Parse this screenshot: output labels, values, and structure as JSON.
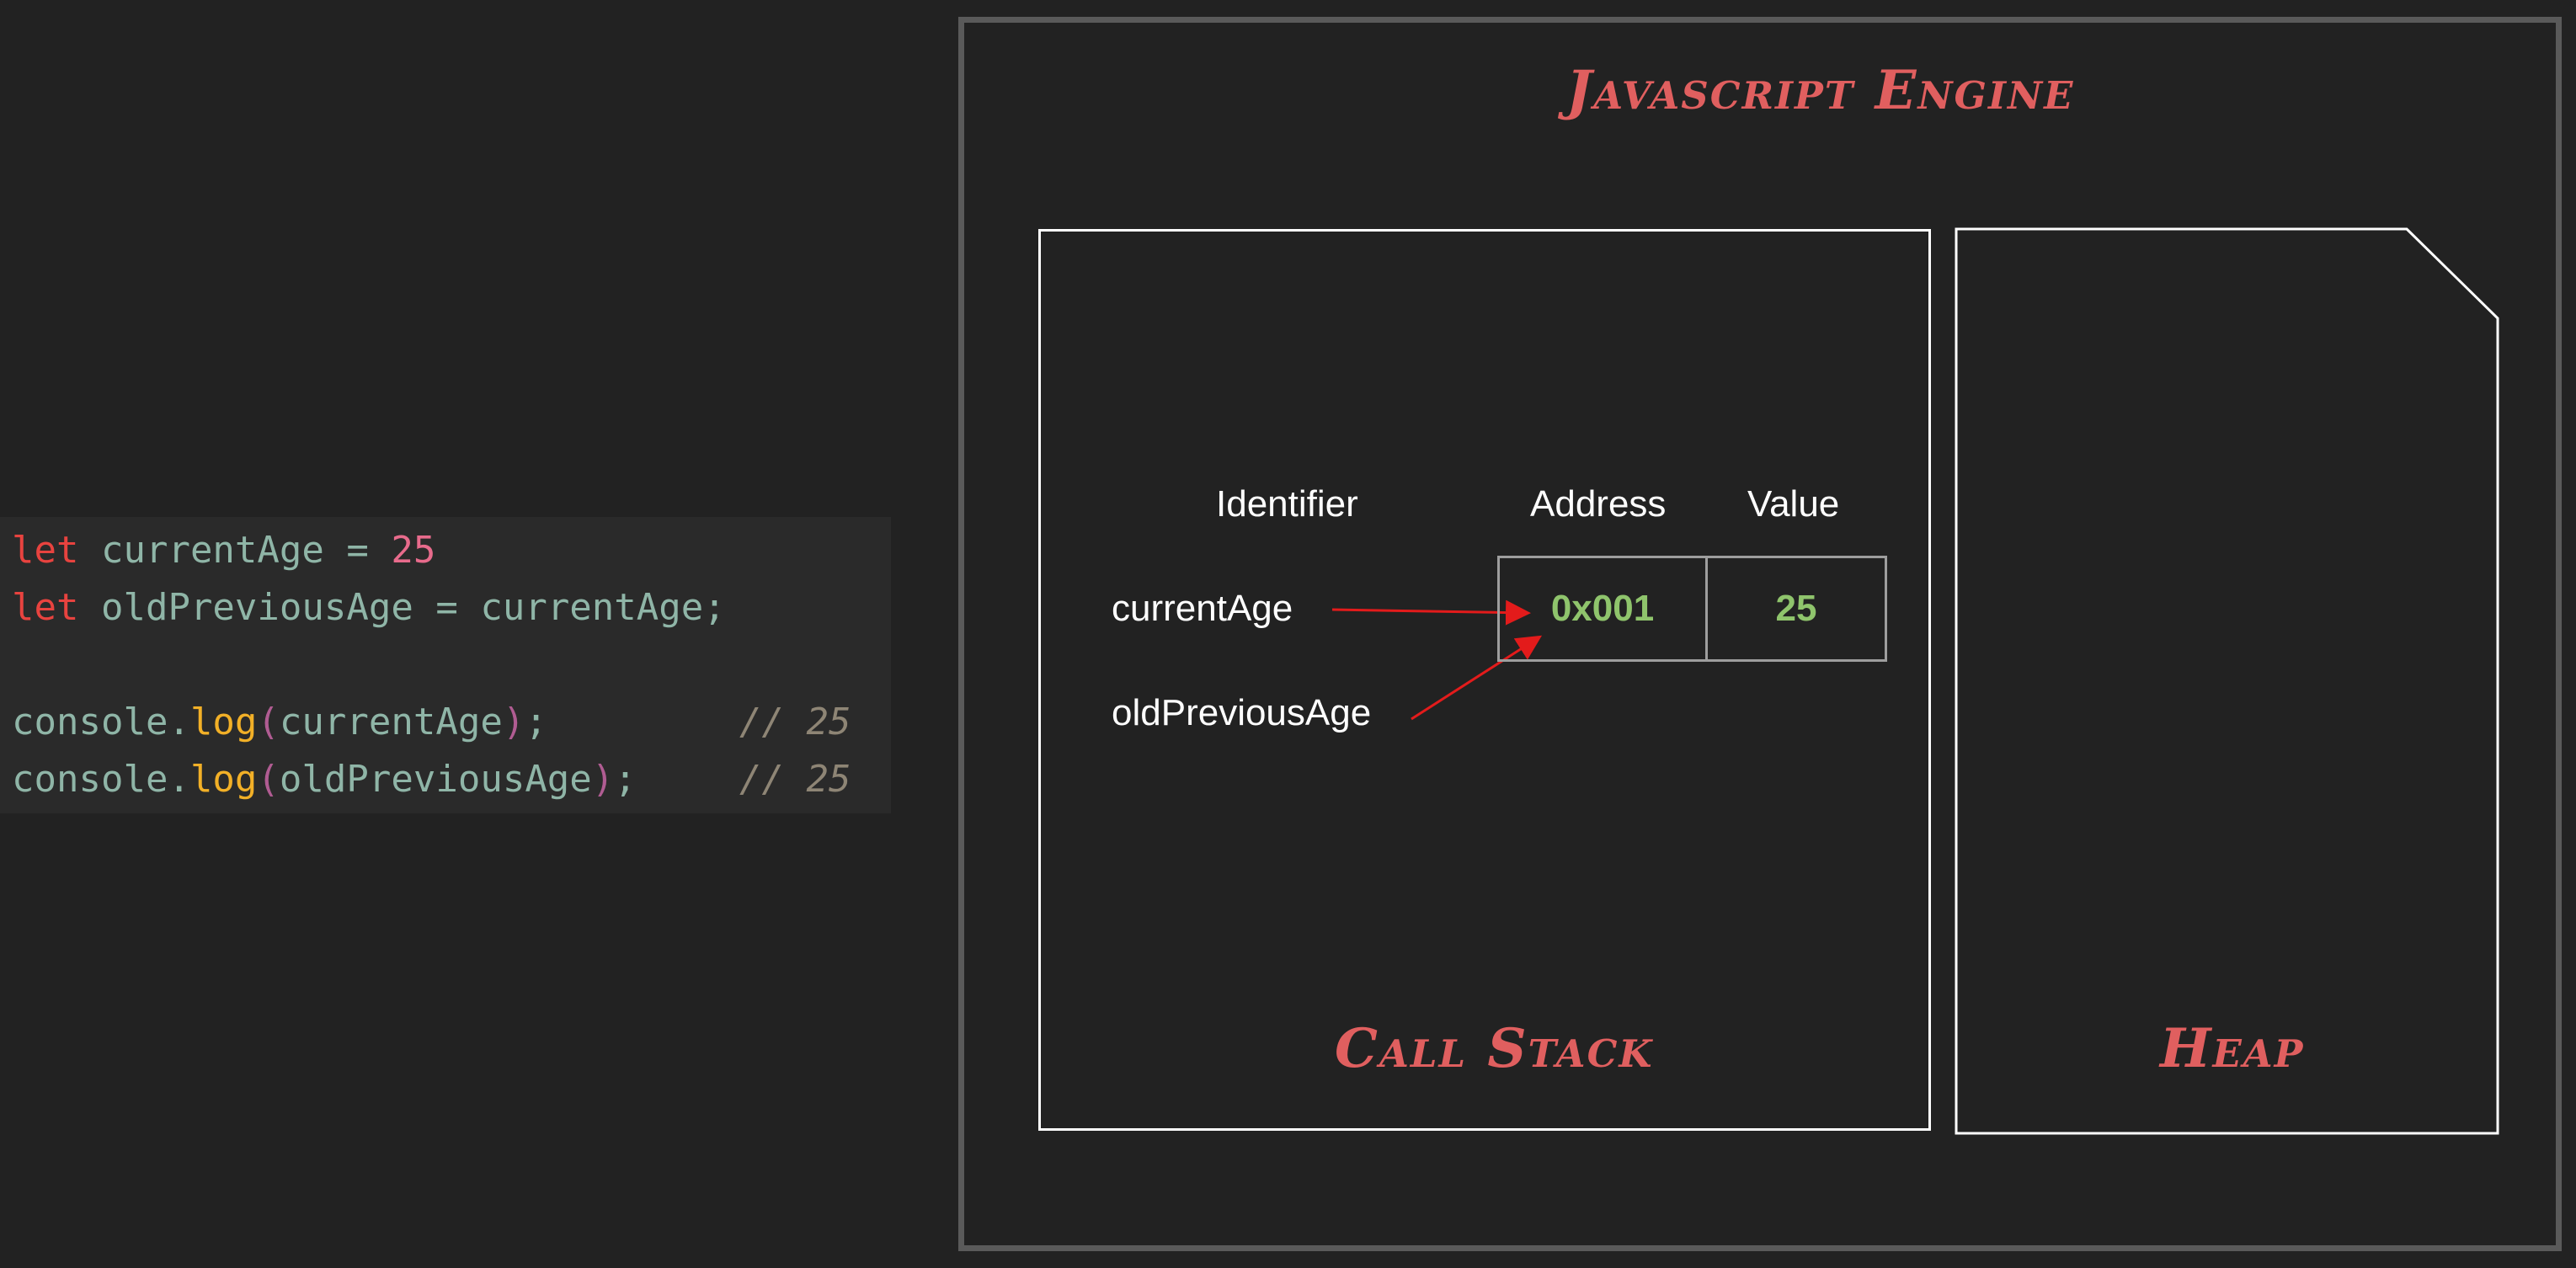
{
  "code": {
    "line1": {
      "kw": "let",
      "name": "currentAge",
      "op": " = ",
      "value": "25"
    },
    "line2": {
      "kw": "let",
      "name": "oldPreviousAge",
      "op": " = ",
      "ref": "currentAge",
      "end": ";"
    },
    "line3": {
      "obj": "console",
      "dot": ".",
      "fn": "log",
      "open": "(",
      "arg": "currentAge",
      "close": ")",
      "end": ";",
      "comment": "// 25"
    },
    "line4": {
      "obj": "console",
      "dot": ".",
      "fn": "log",
      "open": "(",
      "arg": "oldPreviousAge",
      "close": ")",
      "end": ";",
      "comment": "// 25"
    }
  },
  "engine": {
    "title": "Javascript Engine",
    "call_stack": {
      "title": "Call Stack",
      "headers": {
        "identifier": "Identifier",
        "address": "Address",
        "value": "Value"
      },
      "identifiers": [
        "currentAge",
        "oldPreviousAge"
      ],
      "memory": {
        "address": "0x001",
        "value": "25"
      }
    },
    "heap": {
      "title": "Heap"
    }
  },
  "colors": {
    "background": "#222222",
    "title_red": "#e05f5f",
    "arrow_red": "#e31b1b",
    "cell_green": "#8fc46c"
  }
}
